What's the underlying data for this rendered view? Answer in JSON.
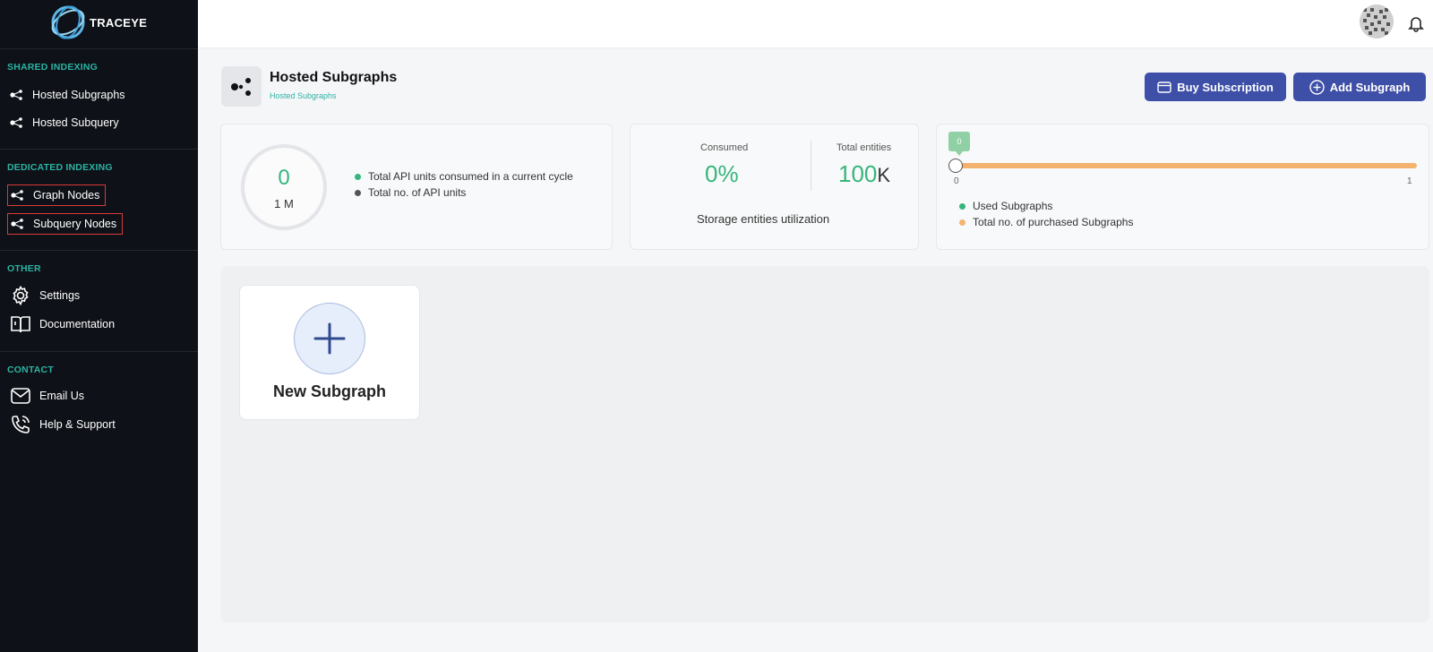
{
  "app": {
    "name": "TRACEYE"
  },
  "sidebar": {
    "sections": [
      {
        "title": "SHARED INDEXING",
        "items": [
          {
            "label": "Hosted Subgraphs",
            "icon": "nodes-icon"
          },
          {
            "label": "Hosted Subquery",
            "icon": "nodes-icon"
          }
        ]
      },
      {
        "title": "DEDICATED INDEXING",
        "items": [
          {
            "label": "Graph Nodes",
            "icon": "nodes-icon",
            "highlighted": true
          },
          {
            "label": "Subquery Nodes",
            "icon": "nodes-icon",
            "highlighted": true
          }
        ]
      },
      {
        "title": "OTHER",
        "items": [
          {
            "label": "Settings",
            "icon": "gear-icon"
          },
          {
            "label": "Documentation",
            "icon": "book-icon"
          }
        ]
      },
      {
        "title": "CONTACT",
        "items": [
          {
            "label": "Email Us",
            "icon": "mail-icon"
          },
          {
            "label": "Help & Support",
            "icon": "phone-icon"
          }
        ]
      }
    ]
  },
  "header": {
    "title": "Hosted Subgraphs",
    "breadcrumb": "Hosted Subgraphs",
    "buy_label": "Buy Subscription",
    "add_label": "Add Subgraph"
  },
  "api_card": {
    "consumed": "0",
    "total": "1 M",
    "legend_consumed": "Total API units consumed in a current cycle",
    "legend_total": "Total no. of API units"
  },
  "storage_card": {
    "consumed_label": "Consumed",
    "consumed_value": "0%",
    "entities_label": "Total entities",
    "entities_value": "100",
    "entities_unit": "K",
    "caption": "Storage entities utilization"
  },
  "subgraph_card": {
    "tooltip_value": "0",
    "min": "0",
    "max": "1",
    "used_label": "Used Subgraphs",
    "total_label": "Total no. of purchased Subgraphs"
  },
  "main": {
    "new_card_label": "New Subgraph"
  },
  "colors": {
    "accent": "#3e4fa7",
    "green": "#35b67b",
    "teal": "#2bb3a3",
    "orange": "#f3b36e",
    "sidebar": "#0e1117"
  }
}
